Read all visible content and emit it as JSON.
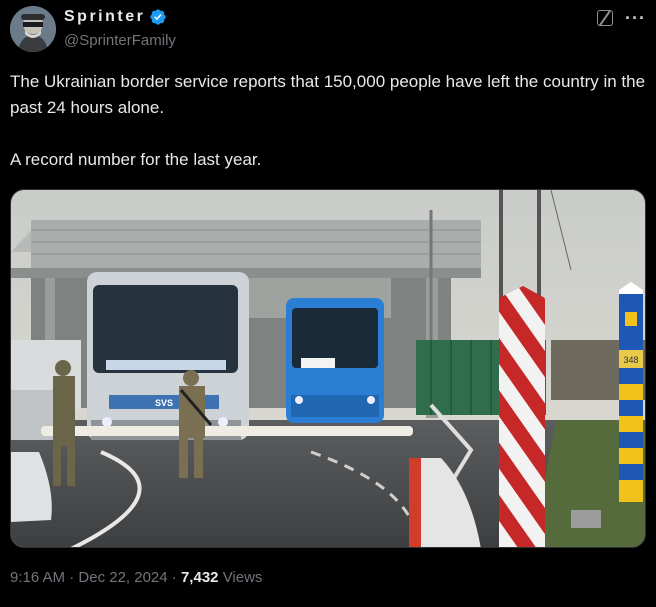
{
  "author": {
    "display_name": "Sprinter",
    "handle": "@SprinterFamily",
    "verified": true,
    "avatar_icon": "profile-avatar"
  },
  "tweet": {
    "paragraphs": [
      "The Ukrainian border service reports that 150,000 people have left the country in the past 24 hours alone.",
      "A record number for the last year."
    ]
  },
  "meta": {
    "time": "9:16 AM",
    "separator": "·",
    "date": "Dec 22, 2024",
    "views_count": "7,432",
    "views_label": "Views"
  },
  "actions": {
    "grok_icon": "grok-icon",
    "more_icon": "more-icon",
    "more_label": "···"
  },
  "media": {
    "bus_plate_text": "SVS",
    "post_sign": "348"
  },
  "colors": {
    "verified": "#1d9bf0",
    "text": "#e7e9ea",
    "muted": "#71767b",
    "background": "#000000"
  }
}
